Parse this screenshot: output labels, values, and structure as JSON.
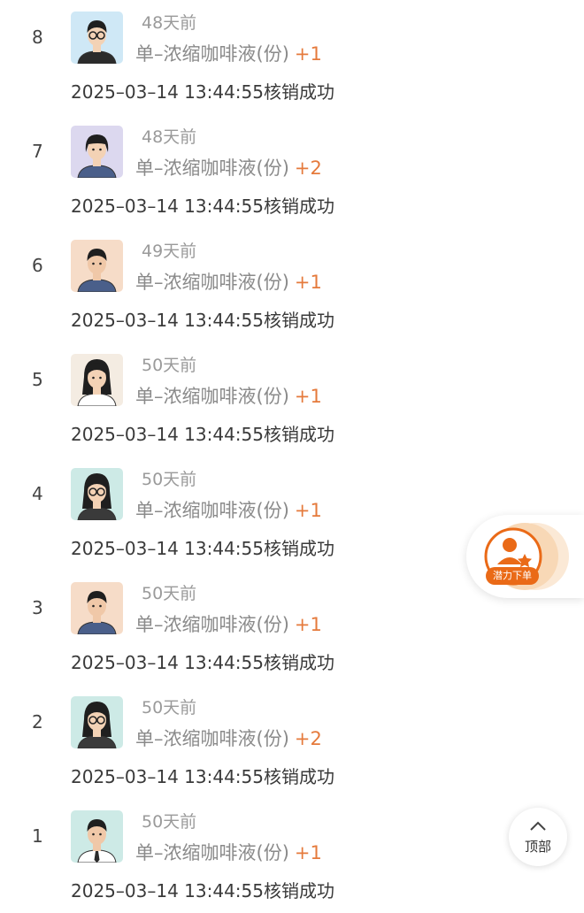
{
  "records": [
    {
      "index": "8",
      "ago": "48天前",
      "product": "单–浓缩咖啡液(份)",
      "qty": "+1",
      "log": "2025–03–14 13:44:55核销成功",
      "avatar": "man-glasses-icon"
    },
    {
      "index": "7",
      "ago": "48天前",
      "product": "单–浓缩咖啡液(份)",
      "qty": "+2",
      "log": "2025–03–14 13:44:55核销成功",
      "avatar": "woman-icon"
    },
    {
      "index": "6",
      "ago": "49天前",
      "product": "单–浓缩咖啡液(份)",
      "qty": "+1",
      "log": "2025–03–14 13:44:55核销成功",
      "avatar": "man-icon"
    },
    {
      "index": "5",
      "ago": "50天前",
      "product": "单–浓缩咖啡液(份)",
      "qty": "+1",
      "log": "2025–03–14 13:44:55核销成功",
      "avatar": "woman-long-hair-icon"
    },
    {
      "index": "4",
      "ago": "50天前",
      "product": "单–浓缩咖啡液(份)",
      "qty": "+1",
      "log": "2025–03–14 13:44:55核销成功",
      "avatar": "woman-glasses-icon"
    },
    {
      "index": "3",
      "ago": "50天前",
      "product": "单–浓缩咖啡液(份)",
      "qty": "+1",
      "log": "2025–03–14 13:44:55核销成功",
      "avatar": "man-icon"
    },
    {
      "index": "2",
      "ago": "50天前",
      "product": "单–浓缩咖啡液(份)",
      "qty": "+2",
      "log": "2025–03–14 13:44:55核销成功",
      "avatar": "woman-glasses-icon"
    },
    {
      "index": "1",
      "ago": "50天前",
      "product": "单–浓缩咖啡液(份)",
      "qty": "+1",
      "log": "2025–03–14 13:44:55核销成功",
      "avatar": "man-tie-icon"
    }
  ],
  "float_badge": {
    "label": "潜力下单",
    "icon": "user-star-icon"
  },
  "back_to_top": {
    "label": "顶部",
    "icon": "chevron-up-icon"
  },
  "colors": {
    "accent": "#e57a3c",
    "badge": "#ea6a17",
    "muted": "#8a8a8a"
  }
}
